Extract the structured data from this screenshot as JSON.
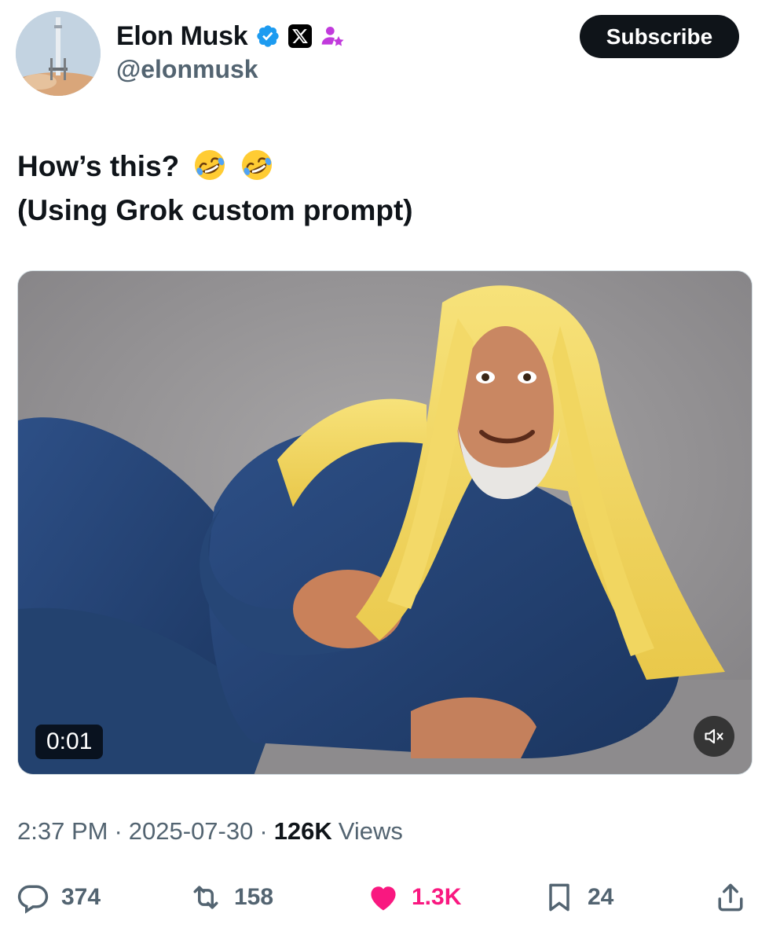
{
  "author": {
    "display_name": "Elon Musk",
    "handle": "@elonmusk",
    "badges": [
      "verified-badge-icon",
      "x-affiliate-icon",
      "grok-companion-icon"
    ]
  },
  "subscribe_label": "Subscribe",
  "tweet": {
    "line1": "How’s this?",
    "line1_emoji": [
      "rolling-on-floor-laughing",
      "rolling-on-floor-laughing"
    ],
    "line2": "(Using Grok custom prompt)"
  },
  "video": {
    "elapsed": "0:01",
    "mute_icon": "volume-muted-icon"
  },
  "meta": {
    "time": "2:37 PM",
    "date": "2025-07-30",
    "views_count": "126K",
    "views_label": "Views",
    "separator": "·"
  },
  "actions": {
    "replies": "374",
    "reposts": "158",
    "likes": "1.3K",
    "bookmarks": "24"
  },
  "colors": {
    "text": "#0f1419",
    "secondary": "#536471",
    "like": "#f91880",
    "verified": "#1d9bf0"
  }
}
